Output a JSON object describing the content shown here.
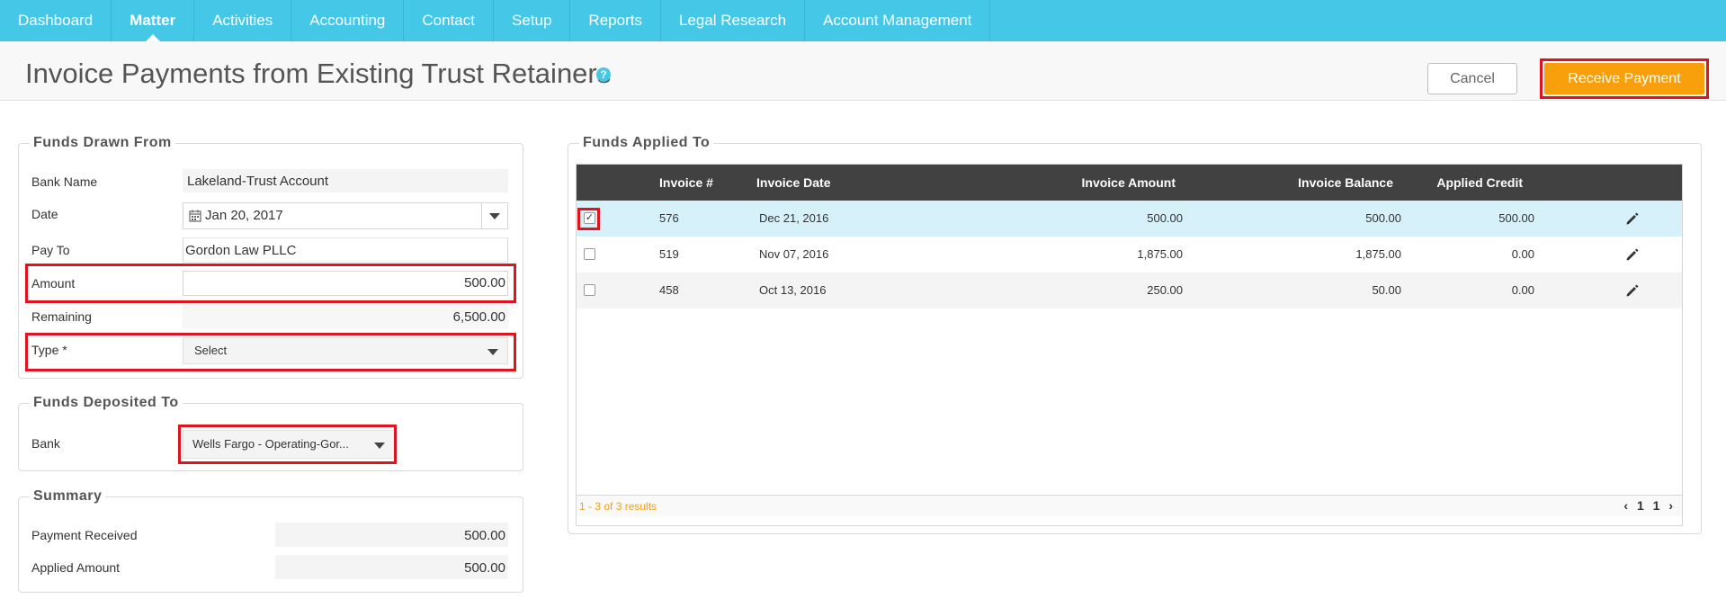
{
  "nav": {
    "items": [
      "Dashboard",
      "Matter",
      "Activities",
      "Accounting",
      "Contact",
      "Setup",
      "Reports",
      "Legal Research",
      "Account Management"
    ],
    "active": "Matter"
  },
  "header": {
    "title": "Invoice Payments from Existing Trust Retainers",
    "help_icon": "question-circle-icon",
    "cancel_label": "Cancel",
    "receive_label": "Receive Payment"
  },
  "funds_drawn": {
    "legend": "Funds Drawn From",
    "bank_name_label": "Bank Name",
    "bank_name_value": "Lakeland-Trust Account",
    "date_label": "Date",
    "date_value": "Jan 20, 2017",
    "pay_to_label": "Pay To",
    "pay_to_value": "Gordon Law PLLC",
    "amount_label": "Amount",
    "amount_value": "500.00",
    "remaining_label": "Remaining",
    "remaining_value": "6,500.00",
    "type_label": "Type *",
    "type_value": "Select"
  },
  "funds_deposited": {
    "legend": "Funds Deposited To",
    "bank_label": "Bank",
    "bank_value": "Wells Fargo - Operating-Gor..."
  },
  "summary": {
    "legend": "Summary",
    "payment_received_label": "Payment Received",
    "payment_received_value": "500.00",
    "applied_amount_label": "Applied Amount",
    "applied_amount_value": "500.00"
  },
  "funds_applied": {
    "legend": "Funds Applied To",
    "columns": [
      "Invoice #",
      "Invoice Date",
      "Invoice Amount",
      "Invoice Balance",
      "Applied Credit"
    ],
    "rows": [
      {
        "checked": true,
        "invoice": "576",
        "date": "Dec 21, 2016",
        "amount": "500.00",
        "balance": "500.00",
        "applied": "500.00"
      },
      {
        "checked": false,
        "invoice": "519",
        "date": "Nov 07, 2016",
        "amount": "1,875.00",
        "balance": "1,875.00",
        "applied": "0.00"
      },
      {
        "checked": false,
        "invoice": "458",
        "date": "Oct 13, 2016",
        "amount": "250.00",
        "balance": "50.00",
        "applied": "0.00"
      }
    ],
    "results_text": "1 - 3 of 3 results",
    "pager": {
      "prev": "‹",
      "page": "1",
      "total": "1",
      "next": "›"
    }
  },
  "colors": {
    "nav_bg": "#45c8e8",
    "accent_orange": "#f7a00c",
    "highlight_red": "#e0141e",
    "table_header": "#414141",
    "selected_row": "#d6f1f9",
    "striped_row": "#f4f4f4"
  }
}
